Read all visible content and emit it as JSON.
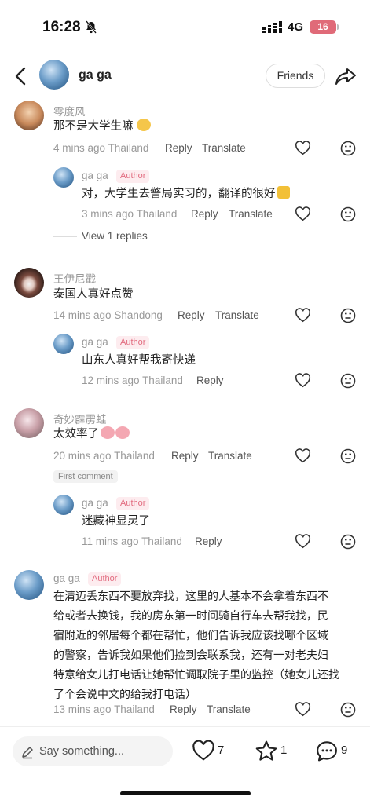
{
  "status_bar": {
    "time": "16:28",
    "network": "4G",
    "battery": "16"
  },
  "header": {
    "name": "ga ga",
    "friends_label": "Friends"
  },
  "comments": [
    {
      "user": "零度风",
      "text": "那不是大学生嘛",
      "time": "4 mins ago",
      "location": "Thailand",
      "reply": "Reply",
      "translate": "Translate"
    },
    {
      "user": "ga ga",
      "badge": "Author",
      "text": "对，大学生去警局实习的，翻译的很好",
      "time": "3 mins ago",
      "location": "Thailand",
      "reply": "Reply",
      "translate": "Translate"
    },
    {
      "user": "王伊尼戳",
      "text": "泰国人真好点赞",
      "time": "14 mins ago",
      "location": "Shandong",
      "reply": "Reply",
      "translate": "Translate"
    },
    {
      "user": "ga ga",
      "badge": "Author",
      "text": "山东人真好帮我寄快递",
      "time": "12 mins ago",
      "location": "Thailand",
      "reply": "Reply"
    },
    {
      "user": "奇妙霹雳蛙",
      "text": "太效率了",
      "time": "20 mins ago",
      "location": "Thailand",
      "reply": "Reply",
      "translate": "Translate",
      "tag": "First comment"
    },
    {
      "user": "ga ga",
      "badge": "Author",
      "text": "迷藏神显灵了",
      "time": "11 mins ago",
      "location": "Thailand",
      "reply": "Reply"
    },
    {
      "user": "ga ga",
      "badge": "Author",
      "text_lines": [
        "在清迈丢东西不要放弃找，这里的人基本不会拿着东西不",
        "给或者去换钱，我的房东第一时间骑自行车去帮我找，民",
        "宿附近的邻居每个都在帮忙，他们告诉我应该找哪个区域",
        "的警察，告诉我如果他们捡到会联系我，还有一对老夫妇",
        "特意给女儿打电话让她帮忙调取院子里的监控（她女儿还找",
        "了个会说中文的给我打电话）"
      ],
      "time": "13 mins ago",
      "location": "Thailand",
      "reply": "Reply",
      "translate": "Translate"
    }
  ],
  "view_replies": "View 1 replies",
  "bottom_bar": {
    "placeholder": "Say something...",
    "likes": "7",
    "stars": "1",
    "comments": "9"
  },
  "colors": {
    "author_badge": "#e26b7f",
    "battery": "#e06a78"
  }
}
